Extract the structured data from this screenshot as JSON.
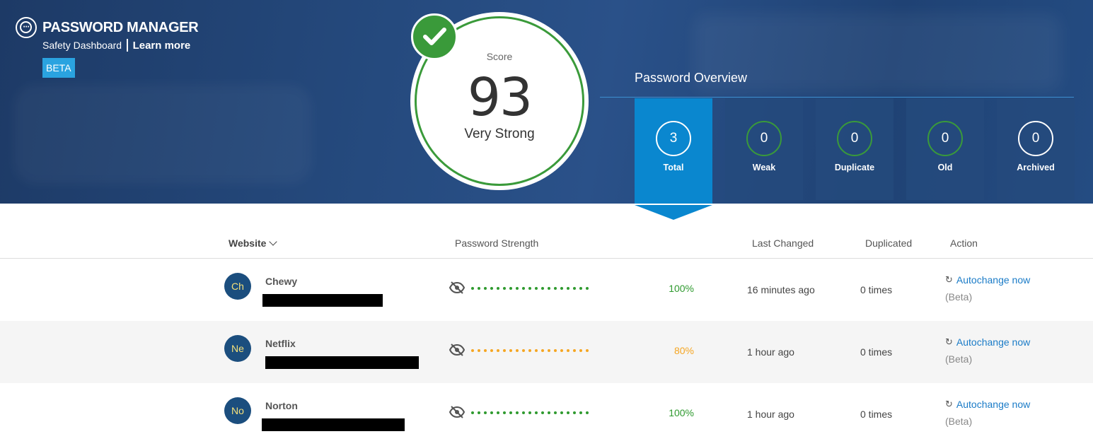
{
  "brand": {
    "title": "PASSWORD MANAGER",
    "subtitle": "Safety Dashboard",
    "learn_more": "Learn more",
    "badge": "BETA"
  },
  "score": {
    "label": "Score",
    "value": "93",
    "rating": "Very Strong",
    "ring_color": "#3a9a3a"
  },
  "overview": {
    "title": "Password Overview",
    "items": [
      {
        "label": "Total",
        "count": "3"
      },
      {
        "label": "Weak",
        "count": "0"
      },
      {
        "label": "Duplicate",
        "count": "0"
      },
      {
        "label": "Old",
        "count": "0"
      },
      {
        "label": "Archived",
        "count": "0"
      }
    ],
    "active": "Total"
  },
  "table": {
    "headers": {
      "website": "Website",
      "strength": "Password Strength",
      "last_changed": "Last Changed",
      "duplicated": "Duplicated",
      "action": "Action"
    },
    "rows": [
      {
        "initials": "Ch",
        "name": "Chewy",
        "strength": "100%",
        "strength_color": "#2f9a2f",
        "last_changed": "16 minutes ago",
        "duplicated": "0 times",
        "action": "Autochange now",
        "action_note": "(Beta)"
      },
      {
        "initials": "Ne",
        "name": "Netflix",
        "strength": "80%",
        "strength_color": "#f5a623",
        "last_changed": "1 hour ago",
        "duplicated": "0 times",
        "action": "Autochange now",
        "action_note": "(Beta)"
      },
      {
        "initials": "No",
        "name": "Norton",
        "strength": "100%",
        "strength_color": "#2f9a2f",
        "last_changed": "1 hour ago",
        "duplicated": "0 times",
        "action": "Autochange now",
        "action_note": "(Beta)"
      }
    ]
  },
  "icons": {
    "brand": "password-manager-logo-icon",
    "check": "checkmark-icon",
    "sort": "chevron-down-icon",
    "hidden": "eye-slash-icon",
    "refresh": "refresh-icon"
  },
  "colors": {
    "banner": "#244a7c",
    "accent": "#0a87cf",
    "green": "#3a9a3a",
    "orange": "#f5a623",
    "link": "#1a7bc7"
  }
}
